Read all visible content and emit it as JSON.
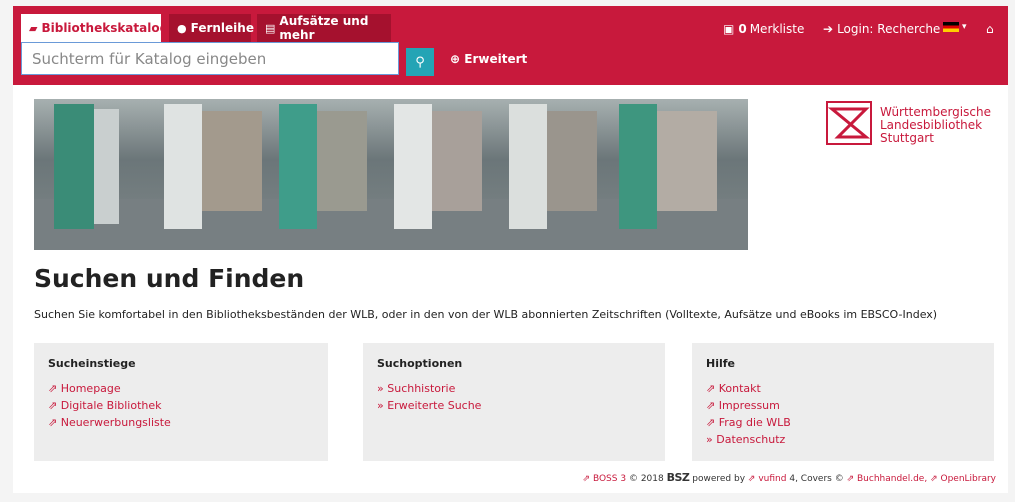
{
  "header": {
    "tabs": [
      {
        "label": "Bibliothekskatalog",
        "icon": "book-icon",
        "active": true
      },
      {
        "label": "Fernleihe",
        "icon": "globe-icon",
        "active": false
      },
      {
        "label": "Aufsätze und mehr",
        "icon": "newspaper-icon",
        "active": false
      }
    ],
    "search": {
      "placeholder": "Suchterm für Katalog eingeben",
      "advanced": "Erweitert"
    },
    "merkliste_count": "0",
    "merkliste_label": "Merkliste",
    "login": "Login: Recherche",
    "color": "#c8193c"
  },
  "logo": {
    "line1": "Württembergische",
    "line2": "Landesbibliothek",
    "line3": "Stuttgart"
  },
  "main": {
    "title": "Suchen und Finden",
    "intro": "Suchen Sie komfortabel in den Bibliotheksbeständen der WLB, oder in den von der WLB abonnierten Zeitschriften (Volltexte, Aufsätze und eBooks im EBSCO-Index)"
  },
  "boxes": [
    {
      "title": "Sucheinstiege",
      "links": [
        "Homepage",
        "Digitale Bibliothek",
        "Neuerwerbungsliste"
      ]
    },
    {
      "title": "Suchoptionen",
      "links": [
        "Suchhistorie",
        "Erweiterte Suche"
      ]
    },
    {
      "title": "Hilfe",
      "links": [
        "Kontakt",
        "Impressum",
        "Frag die WLB",
        "Datenschutz"
      ]
    }
  ],
  "footer": {
    "boss": "BOSS 3",
    "copyright": "© 2018",
    "bsz": "BSZ",
    "powered": "powered by",
    "vufind": "vufind",
    "vufind_ver": "4, Covers ©",
    "buchhandel": "Buchhandel.de,",
    "openlibrary": "OpenLibrary"
  }
}
